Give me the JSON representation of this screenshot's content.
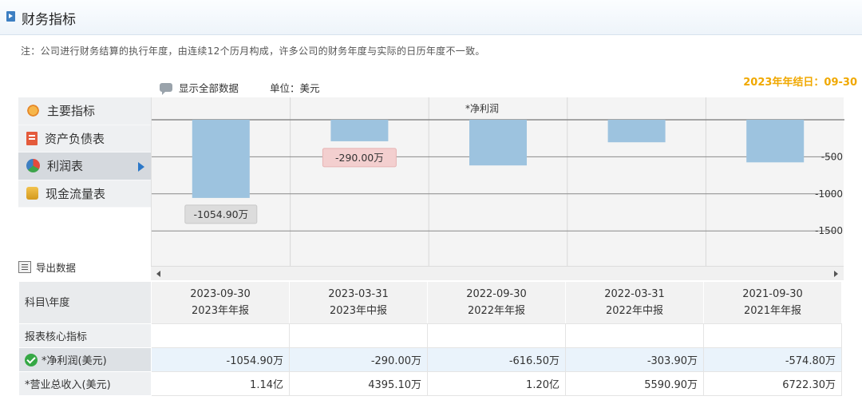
{
  "header": {
    "title": "财务指标"
  },
  "note": "注：公司进行财务结算的执行年度，由连续12个历月构成，许多公司的财务年度与实际的日历年度不一致。",
  "toolbar": {
    "show_all": "显示全部数据",
    "unit": "单位：美元",
    "year_end": "2023年年结日：09-30"
  },
  "menu": {
    "items": [
      {
        "label": "主要指标",
        "icon": "gear-icon"
      },
      {
        "label": "资产负债表",
        "icon": "document-icon"
      },
      {
        "label": "利润表",
        "icon": "pie-chart-icon",
        "active": true
      },
      {
        "label": "现金流量表",
        "icon": "coins-icon"
      }
    ]
  },
  "export_label": "导出数据",
  "chart_data": {
    "type": "bar",
    "title": "*净利润",
    "categories": [
      "2023-09-30",
      "2023-03-31",
      "2022-09-30",
      "2022-03-31",
      "2021-09-30"
    ],
    "values": [
      -1054.9,
      -290.0,
      -616.5,
      -303.9,
      -574.8
    ],
    "ylim": [
      -1650,
      0
    ],
    "yticks": [
      -500,
      -1000,
      -1500
    ],
    "ytick_labels": [
      "-500",
      "-1000",
      "-1500"
    ],
    "data_labels": [
      {
        "index": 0,
        "text": "-1054.90万",
        "style": "gray"
      },
      {
        "index": 1,
        "text": "-290.00万",
        "style": "pink"
      }
    ],
    "bar_color": "#9dc3df",
    "grid": true
  },
  "table": {
    "corner": "科目\\年度",
    "columns": [
      {
        "date": "2023-09-30",
        "type": "2023年年报"
      },
      {
        "date": "2023-03-31",
        "type": "2023年中报"
      },
      {
        "date": "2022-09-30",
        "type": "2022年年报"
      },
      {
        "date": "2022-03-31",
        "type": "2022年中报"
      },
      {
        "date": "2021-09-30",
        "type": "2021年年报"
      }
    ],
    "section_label": "报表核心指标",
    "rows": [
      {
        "label": "*净利润(美元)",
        "values": [
          "-1054.90万",
          "-290.00万",
          "-616.50万",
          "-303.90万",
          "-574.80万"
        ]
      },
      {
        "label": "*营业总收入(美元)",
        "values": [
          "1.14亿",
          "4395.10万",
          "1.20亿",
          "5590.90万",
          "6722.30万"
        ]
      }
    ]
  }
}
